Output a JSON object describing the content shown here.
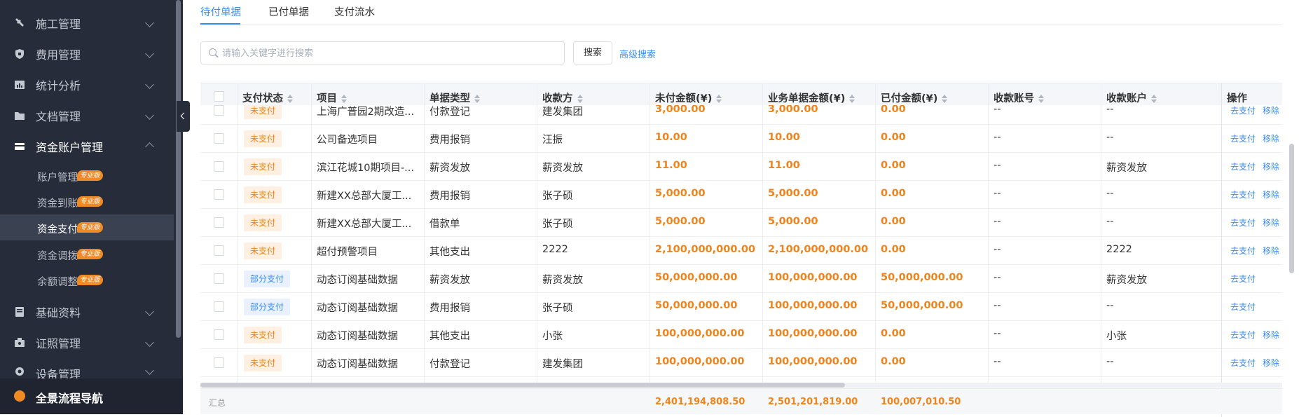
{
  "sidebar": {
    "groups": [
      {
        "label": "施工管理",
        "icon": "tools-icon"
      },
      {
        "label": "费用管理",
        "icon": "shield-icon"
      },
      {
        "label": "统计分析",
        "icon": "chart-icon"
      },
      {
        "label": "文档管理",
        "icon": "folder-icon"
      },
      {
        "label": "资金账户管理",
        "icon": "card-icon"
      },
      {
        "label": "基础资料",
        "icon": "book-icon"
      },
      {
        "label": "证照管理",
        "icon": "certificate-icon"
      },
      {
        "label": "设备管理",
        "icon": "device-icon"
      }
    ],
    "sub_items": [
      {
        "label": "账户管理",
        "badge": "专业版"
      },
      {
        "label": "资金到账",
        "badge": "专业版"
      },
      {
        "label": "资金支付",
        "badge": "专业版"
      },
      {
        "label": "资金调拨",
        "badge": "专业版"
      },
      {
        "label": "余额调整",
        "badge": "专业版"
      }
    ],
    "footer": "全景流程导航"
  },
  "tabs": [
    "待付单据",
    "已付单据",
    "支付流水"
  ],
  "search": {
    "placeholder": "请输入关键字进行搜索",
    "button": "搜索",
    "advanced": "高级搜索"
  },
  "table": {
    "columns": [
      "支付状态",
      "项目",
      "单据类型",
      "收款方",
      "未付金额(¥)",
      "业务单据金额(¥)",
      "已付金额(¥)",
      "收款账号",
      "收款账户",
      "操作"
    ],
    "partial_row": {
      "status": "未支付",
      "project": "上海广普园2期改造...",
      "type": "付款登记",
      "payee": "建发集团",
      "unpaid": "3,000.00",
      "total": "3,000.00",
      "paid": "0.00",
      "account_no": "--",
      "account": "--",
      "act1": "去支付",
      "act2": "移除"
    },
    "rows": [
      {
        "status": "未支付",
        "status_type": "unpaid",
        "project": "公司备选项目",
        "type": "费用报销",
        "payee": "汪振",
        "unpaid": "10.00",
        "total": "10.00",
        "paid": "0.00",
        "account_no": "--",
        "account": "--",
        "act1": "去支付",
        "act2": "移除"
      },
      {
        "status": "未支付",
        "status_type": "unpaid",
        "project": "滨江花城10期项目-...",
        "type": "薪资发放",
        "payee": "薪资发放",
        "unpaid": "11.00",
        "total": "11.00",
        "paid": "0.00",
        "account_no": "--",
        "account": "薪资发放",
        "act1": "去支付",
        "act2": "移除"
      },
      {
        "status": "未支付",
        "status_type": "unpaid",
        "project": "新建XX总部大厦工...",
        "type": "费用报销",
        "payee": "张子硕",
        "unpaid": "5,000.00",
        "total": "5,000.00",
        "paid": "0.00",
        "account_no": "--",
        "account": "--",
        "act1": "去支付",
        "act2": "移除"
      },
      {
        "status": "未支付",
        "status_type": "unpaid",
        "project": "新建XX总部大厦工...",
        "type": "借款单",
        "payee": "张子硕",
        "unpaid": "5,000.00",
        "total": "5,000.00",
        "paid": "0.00",
        "account_no": "--",
        "account": "--",
        "act1": "去支付",
        "act2": "移除"
      },
      {
        "status": "未支付",
        "status_type": "unpaid",
        "project": "超付预警项目",
        "type": "其他支出",
        "payee": "2222",
        "unpaid": "2,100,000,000.00",
        "total": "2,100,000,000.00",
        "paid": "0.00",
        "account_no": "--",
        "account": "2222",
        "act1": "去支付",
        "act2": "移除"
      },
      {
        "status": "部分支付",
        "status_type": "partial",
        "project": "动态订阅基础数据",
        "type": "薪资发放",
        "payee": "薪资发放",
        "unpaid": "50,000,000.00",
        "total": "100,000,000.00",
        "paid": "50,000,000.00",
        "account_no": "--",
        "account": "薪资发放",
        "act1": "去支付",
        "act2": ""
      },
      {
        "status": "部分支付",
        "status_type": "partial",
        "project": "动态订阅基础数据",
        "type": "费用报销",
        "payee": "张子硕",
        "unpaid": "50,000,000.00",
        "total": "100,000,000.00",
        "paid": "50,000,000.00",
        "account_no": "--",
        "account": "--",
        "act1": "去支付",
        "act2": ""
      },
      {
        "status": "未支付",
        "status_type": "unpaid",
        "project": "动态订阅基础数据",
        "type": "其他支出",
        "payee": "小张",
        "unpaid": "100,000,000.00",
        "total": "100,000,000.00",
        "paid": "0.00",
        "account_no": "--",
        "account": "小张",
        "act1": "去支付",
        "act2": "移除"
      },
      {
        "status": "未支付",
        "status_type": "unpaid",
        "project": "动态订阅基础数据",
        "type": "付款登记",
        "payee": "建发集团",
        "unpaid": "100,000,000.00",
        "total": "100,000,000.00",
        "paid": "0.00",
        "account_no": "--",
        "account": "--",
        "act1": "去支付",
        "act2": "移除"
      }
    ],
    "summary": {
      "label": "汇总",
      "unpaid": "2,401,194,808.50",
      "total": "2,501,201,819.00",
      "paid": "100,007,010.50"
    }
  },
  "colors": {
    "accent": "#3b8cf2",
    "amount": "#f0841a",
    "sidebar_bg": "#262c39",
    "badge": "#f08a24"
  }
}
